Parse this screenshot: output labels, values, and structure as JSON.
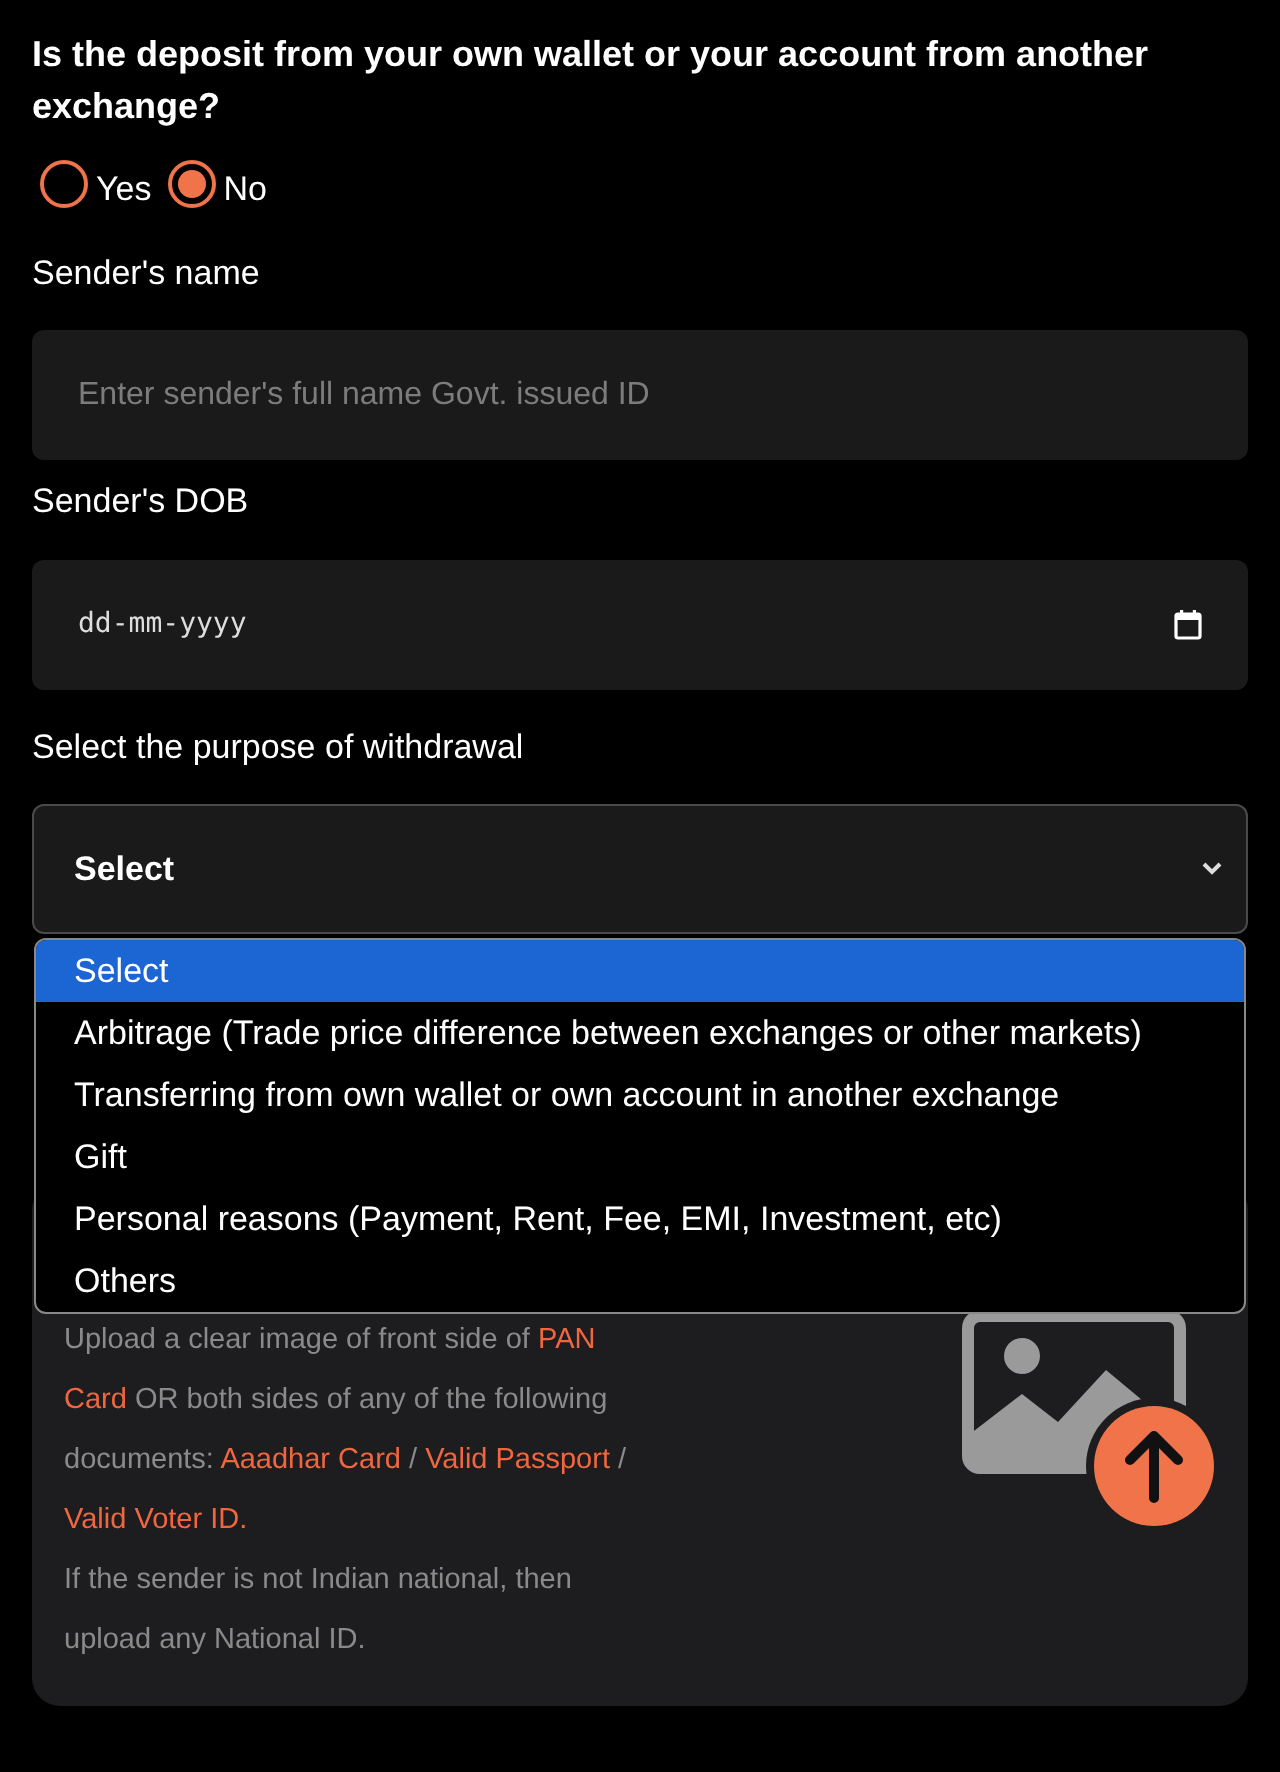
{
  "question": "Is the deposit from your own wallet or your account from another exchange?",
  "radios": [
    {
      "label": "Yes",
      "selected": false
    },
    {
      "label": "No",
      "selected": true
    }
  ],
  "name_field": {
    "label": "Sender's name",
    "placeholder": "Enter sender's full name Govt. issued ID"
  },
  "dob_field": {
    "label": "Sender's DOB",
    "placeholder": "dd-mm-yyyy"
  },
  "purpose": {
    "label": "Select the purpose of withdrawal",
    "value": "Select",
    "expanded": true,
    "options": [
      {
        "label": "Select",
        "selected": true
      },
      {
        "label": "Arbitrage (Trade price difference between exchanges or other markets)",
        "selected": false
      },
      {
        "label": "Transferring from own wallet or own account in another exchange",
        "selected": false
      },
      {
        "label": "Gift",
        "selected": false
      },
      {
        "label": "Personal reasons (Payment, Rent, Fee, EMI, Investment, etc)",
        "selected": false
      },
      {
        "label": "Others",
        "selected": false
      }
    ]
  },
  "upload": {
    "instructions": [
      {
        "kind": "text",
        "text": "Upload a clear image of front side of "
      },
      {
        "kind": "highlight",
        "text": "PAN Card"
      },
      {
        "kind": "text",
        "text": " OR both sides of any of the following documents: "
      },
      {
        "kind": "highlight",
        "text": "Aaadhar Card"
      },
      {
        "kind": "text",
        "text": " / "
      },
      {
        "kind": "highlight",
        "text": "Valid Passport"
      },
      {
        "kind": "text",
        "text": " / "
      },
      {
        "kind": "highlight",
        "text": "Valid Voter ID."
      }
    ],
    "note": "If the sender is not Indian national, then upload any National ID."
  }
}
